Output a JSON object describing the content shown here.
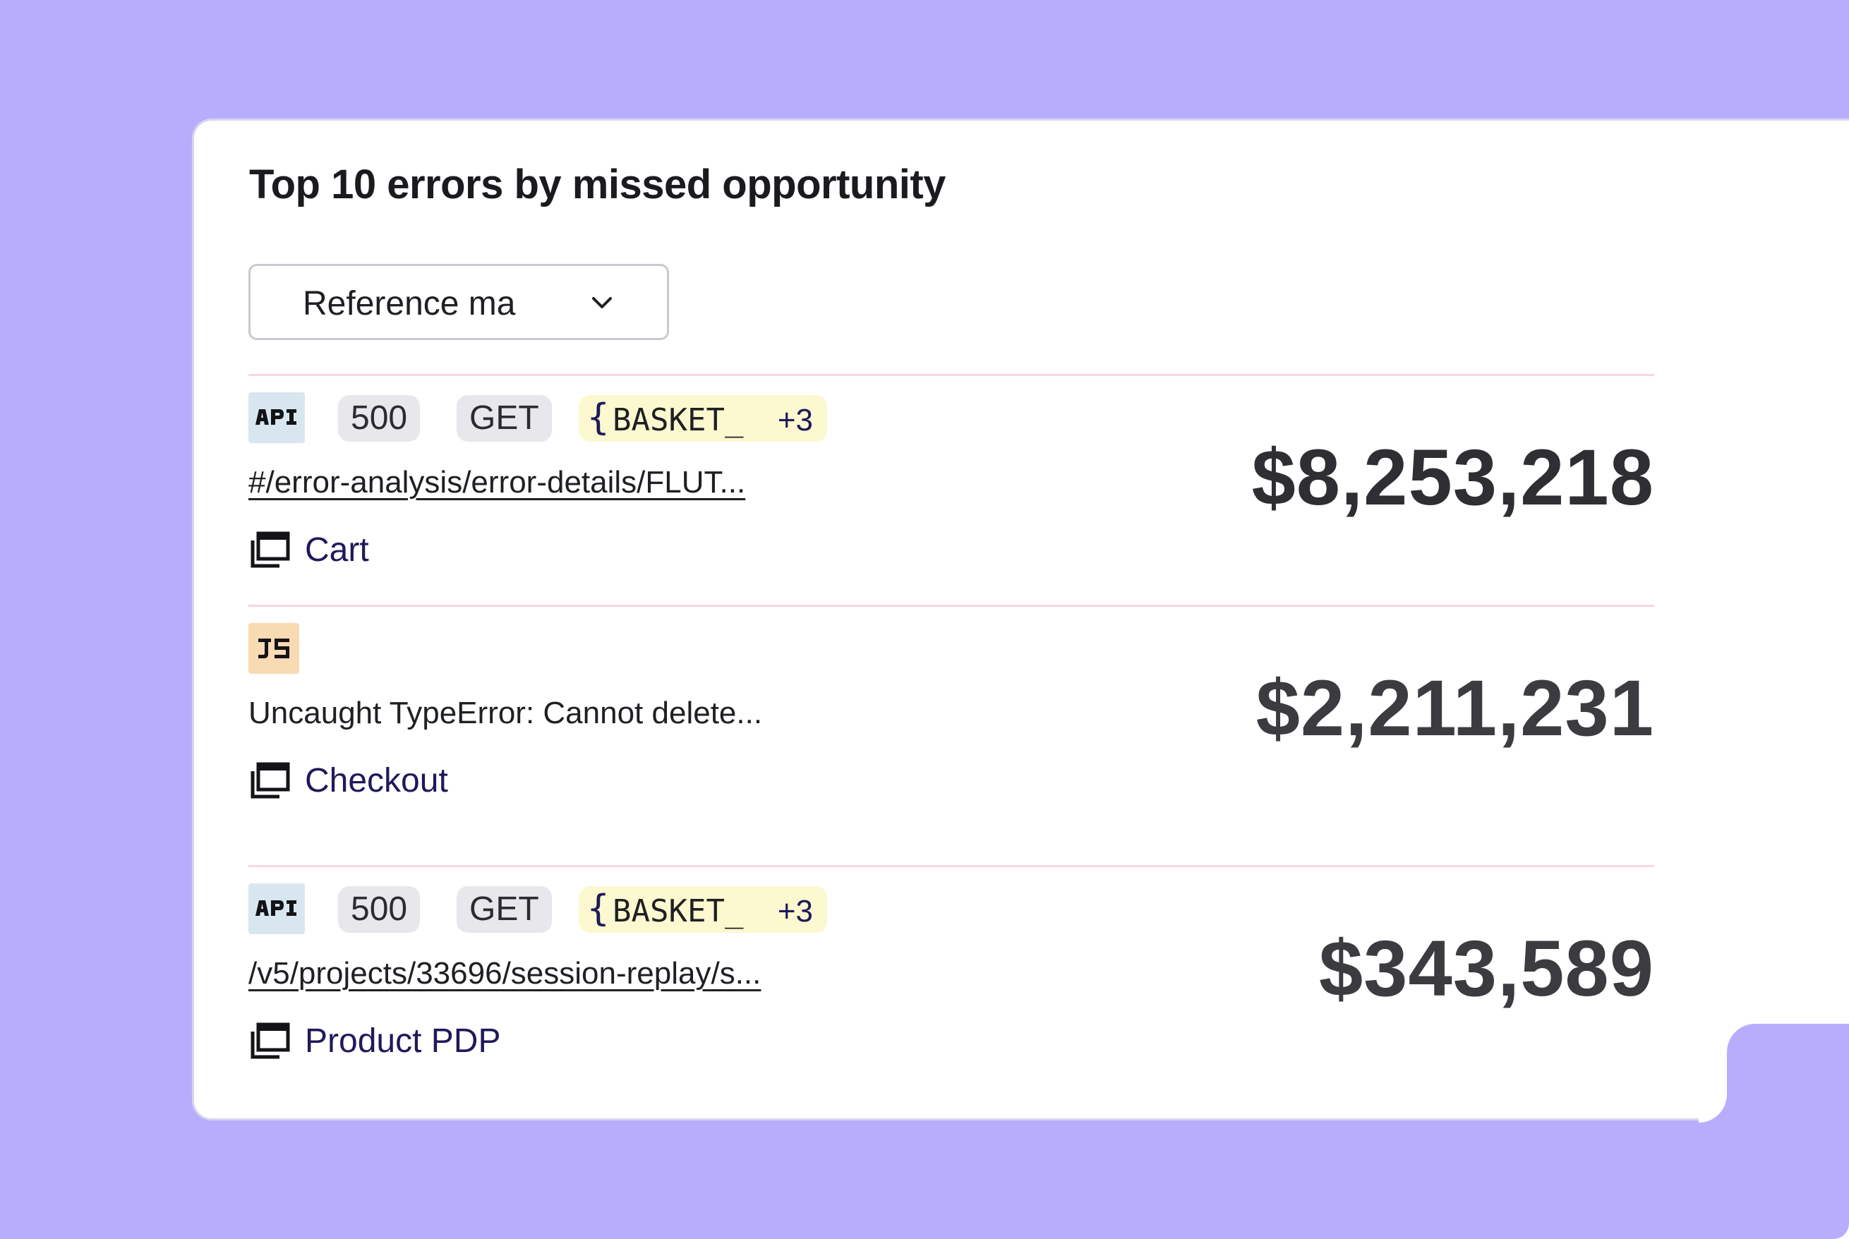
{
  "widget": {
    "title": "Top 10 errors by missed opportunity",
    "filter": {
      "selected": "Reference ma",
      "icon": "chevron-down-icon"
    }
  },
  "errors": [
    {
      "type_badge": "API",
      "status": "500",
      "method": "GET",
      "variable": "BASKET_",
      "variable_more": "+3",
      "message": "#/error-analysis/error-details/FLUT...",
      "page_icon": "page-stack-icon",
      "page": "Cart",
      "amount": "$8,253,218"
    },
    {
      "type_badge": "JS",
      "message": "Uncaught TypeError: Cannot delete...",
      "page_icon": "page-stack-icon",
      "page": "Checkout",
      "amount": "$2,211,231"
    },
    {
      "type_badge": "API",
      "status": "500",
      "method": "GET",
      "variable": "BASKET_",
      "variable_more": "+3",
      "message": "/v5/projects/33696/session-replay/s...",
      "page_icon": "page-stack-icon",
      "page": "Product PDP",
      "amount": "$343,589"
    }
  ],
  "colors": {
    "background": "#b6aefd",
    "card": "#ffffff",
    "divider": "#f6d7e1",
    "api_badge": "#d7e6ef",
    "js_badge": "#f8dab3",
    "variable_pill": "#fcf8cf",
    "neutral_pill": "#e7e7ec",
    "link": "#1e1a5a",
    "amount": "#2e2e33"
  }
}
